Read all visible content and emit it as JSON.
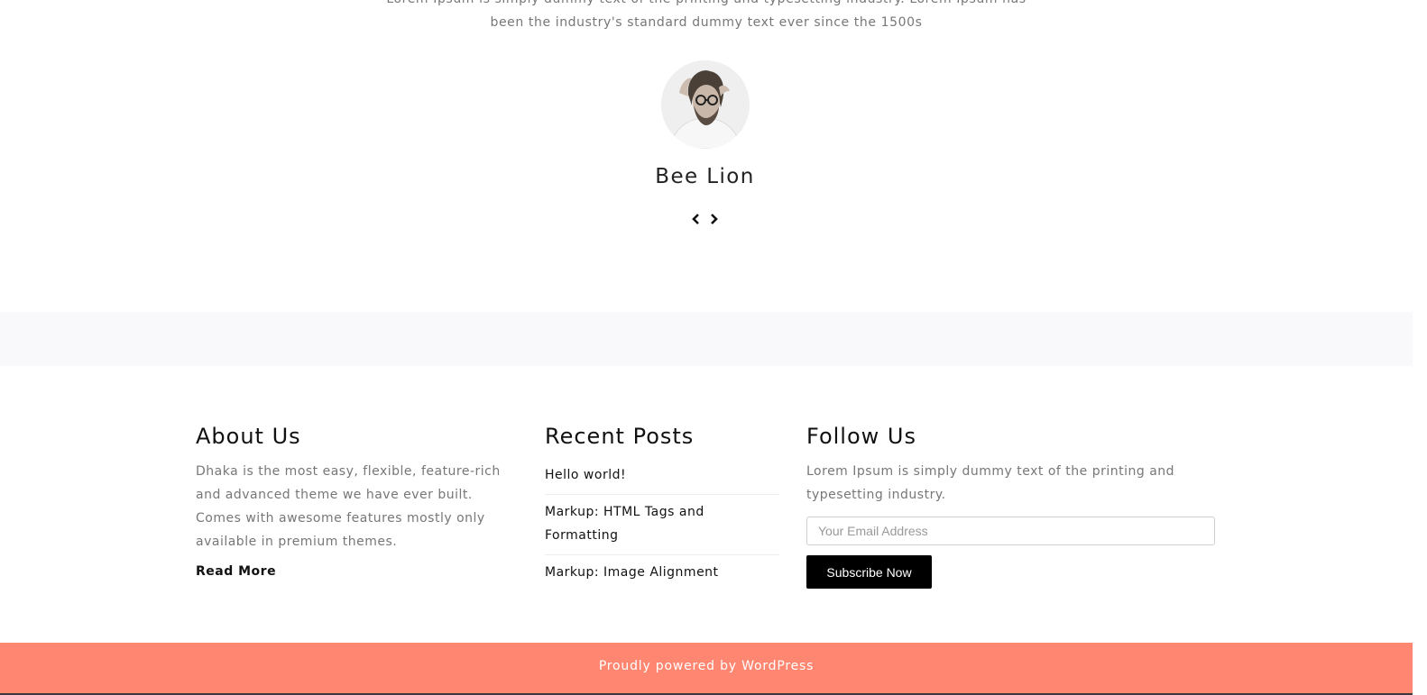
{
  "testimonial": {
    "text_line1": "Lorem Ipsum is simply dummy text of the printing and typesetting industry. Lorem Ipsum has",
    "text_line2": "been the industry's standard dummy text ever since the 1500s",
    "name": "Bee Lion",
    "prev_icon": "chevron-left-icon",
    "next_icon": "chevron-right-icon"
  },
  "footer_widgets": {
    "about": {
      "title": "About Us",
      "text": "Dhaka is the most easy, flexible, feature-rich and advanced theme we have ever built. Comes with awesome features mostly only available in premium themes.",
      "read_more": "Read More"
    },
    "recent_posts": {
      "title": "Recent Posts",
      "items": [
        {
          "label": "Hello world!"
        },
        {
          "label": "Markup: HTML Tags and Formatting"
        },
        {
          "label": "Markup: Image Alignment"
        }
      ]
    },
    "follow": {
      "title": "Follow Us",
      "text": "Lorem Ipsum is simply dummy text of the printing and typesetting industry.",
      "email_placeholder": "Your Email Address",
      "subscribe_label": "Subscribe Now"
    }
  },
  "site_footer": {
    "prefix": "Proudly powered by ",
    "link": "WordPress"
  },
  "colors": {
    "footer_bg": "#ff8670",
    "button_bg": "#000000",
    "band_bg": "#f9f9fb"
  }
}
